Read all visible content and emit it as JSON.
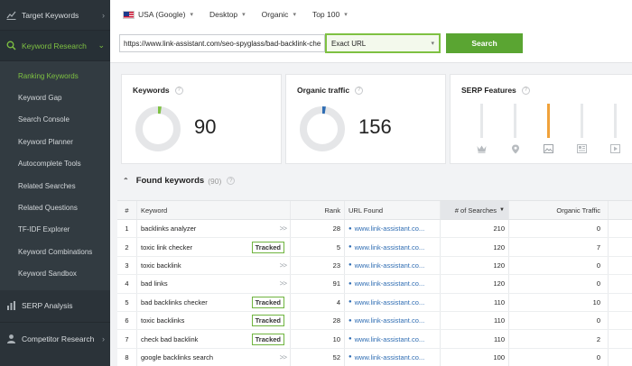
{
  "sidebar": {
    "sections": {
      "target": {
        "label": "Target Keywords",
        "icon": "trend-chart-icon"
      },
      "research": {
        "label": "Keyword Research",
        "icon": "search-icon"
      },
      "serp": {
        "label": "SERP Analysis",
        "icon": "bar-chart-icon"
      },
      "competitor": {
        "label": "Competitor Research",
        "icon": "user-icon"
      }
    },
    "items": [
      {
        "label": "Ranking Keywords",
        "active": true
      },
      {
        "label": "Keyword Gap"
      },
      {
        "label": "Search Console"
      },
      {
        "label": "Keyword Planner"
      },
      {
        "label": "Autocomplete Tools"
      },
      {
        "label": "Related Searches"
      },
      {
        "label": "Related Questions"
      },
      {
        "label": "TF-IDF Explorer"
      },
      {
        "label": "Keyword Combinations"
      },
      {
        "label": "Keyword Sandbox"
      }
    ]
  },
  "filters": {
    "country": "USA (Google)",
    "device": "Desktop",
    "type": "Organic",
    "top": "Top 100"
  },
  "search": {
    "url": "https://www.link-assistant.com/seo-spyglass/bad-backlink-checker",
    "mode": "Exact URL",
    "button": "Search"
  },
  "cards": {
    "keywords": {
      "title": "Keywords",
      "value": "90"
    },
    "traffic": {
      "title": "Organic traffic",
      "value": "156"
    },
    "serp": {
      "title": "SERP Features",
      "levels": [
        0,
        0,
        1,
        0,
        0
      ],
      "icons": [
        "crown-icon",
        "location-pin-icon",
        "image-icon",
        "news-icon",
        "video-icon"
      ]
    }
  },
  "colors": {
    "accent": "#7ec142",
    "button": "#5aa532",
    "sidebar": "#2b3339",
    "link": "#2f6db3",
    "serp_bar": "#f0a23a"
  },
  "found": {
    "title": "Found keywords",
    "count": "(90)"
  },
  "table": {
    "headers": {
      "num": "#",
      "keyword": "Keyword",
      "rank": "Rank",
      "url": "URL Found",
      "searches": "# of Searches",
      "traffic": "Organic Traffic"
    },
    "tracked_label": "Tracked",
    "rows": [
      {
        "num": "1",
        "keyword": "backlinks analyzer",
        "tracked": false,
        "rank": "28",
        "url": "www.link-assistant.co...",
        "searches": "210",
        "traffic": "0"
      },
      {
        "num": "2",
        "keyword": "toxic link checker",
        "tracked": true,
        "rank": "5",
        "url": "www.link-assistant.co...",
        "searches": "120",
        "traffic": "7"
      },
      {
        "num": "3",
        "keyword": "toxic backlink",
        "tracked": false,
        "rank": "23",
        "url": "www.link-assistant.co...",
        "searches": "120",
        "traffic": "0"
      },
      {
        "num": "4",
        "keyword": "bad links",
        "tracked": false,
        "rank": "91",
        "url": "www.link-assistant.co...",
        "searches": "120",
        "traffic": "0"
      },
      {
        "num": "5",
        "keyword": "bad backlinks checker",
        "tracked": true,
        "rank": "4",
        "url": "www.link-assistant.co...",
        "searches": "110",
        "traffic": "10"
      },
      {
        "num": "6",
        "keyword": "toxic backlinks",
        "tracked": true,
        "rank": "28",
        "url": "www.link-assistant.co...",
        "searches": "110",
        "traffic": "0"
      },
      {
        "num": "7",
        "keyword": "check bad backlink",
        "tracked": true,
        "rank": "10",
        "url": "www.link-assistant.co...",
        "searches": "110",
        "traffic": "2"
      },
      {
        "num": "8",
        "keyword": "google backlinks search",
        "tracked": false,
        "rank": "52",
        "url": "www.link-assistant.co...",
        "searches": "100",
        "traffic": "0"
      }
    ]
  }
}
